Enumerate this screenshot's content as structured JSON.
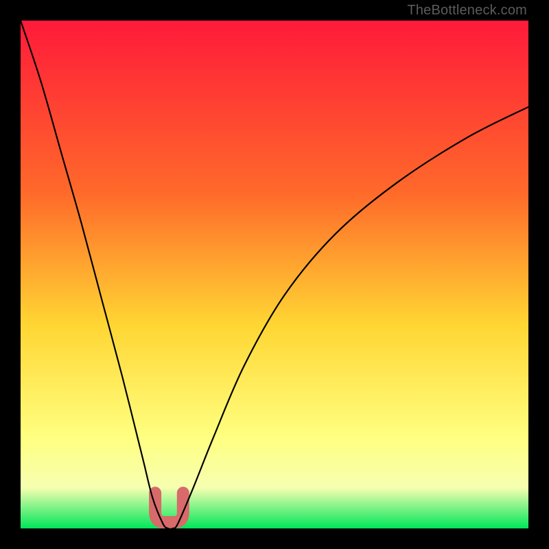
{
  "watermark": {
    "text": "TheBottleneck.com"
  },
  "colors": {
    "background": "#000000",
    "gradient_top": "#ff1a3a",
    "gradient_mid_upper": "#ff6a2a",
    "gradient_mid": "#ffd633",
    "gradient_mid_lower": "#ffff80",
    "gradient_lower": "#f6ffb0",
    "gradient_bottom": "#00e65a",
    "curve": "#000000",
    "valley_marker": "#d86a6a"
  },
  "chart_data": {
    "type": "line",
    "title": "",
    "xlabel": "",
    "ylabel": "",
    "xlim": [
      0,
      100
    ],
    "ylim": [
      0,
      100
    ],
    "series": [
      {
        "name": "bottleneck-curve",
        "x": [
          0,
          4,
          8,
          12,
          16,
          20,
          24,
          26,
          28,
          29,
          30,
          31,
          34,
          38,
          44,
          52,
          62,
          74,
          88,
          100
        ],
        "y": [
          100,
          88,
          74,
          60,
          45,
          30,
          14,
          6,
          1,
          0,
          0,
          1,
          8,
          18,
          32,
          46,
          58,
          68,
          77,
          83
        ]
      }
    ],
    "markers": [
      {
        "name": "valley-marker",
        "shape": "u",
        "x_range": [
          26.5,
          32.0
        ],
        "y_range": [
          0,
          7
        ],
        "stroke_width": 18
      }
    ],
    "gradient_stops": [
      {
        "offset": 0.0,
        "value": 100
      },
      {
        "offset": 0.45,
        "value": 55
      },
      {
        "offset": 0.75,
        "value": 25
      },
      {
        "offset": 0.88,
        "value": 12
      },
      {
        "offset": 0.95,
        "value": 5
      },
      {
        "offset": 1.0,
        "value": 0
      }
    ]
  }
}
